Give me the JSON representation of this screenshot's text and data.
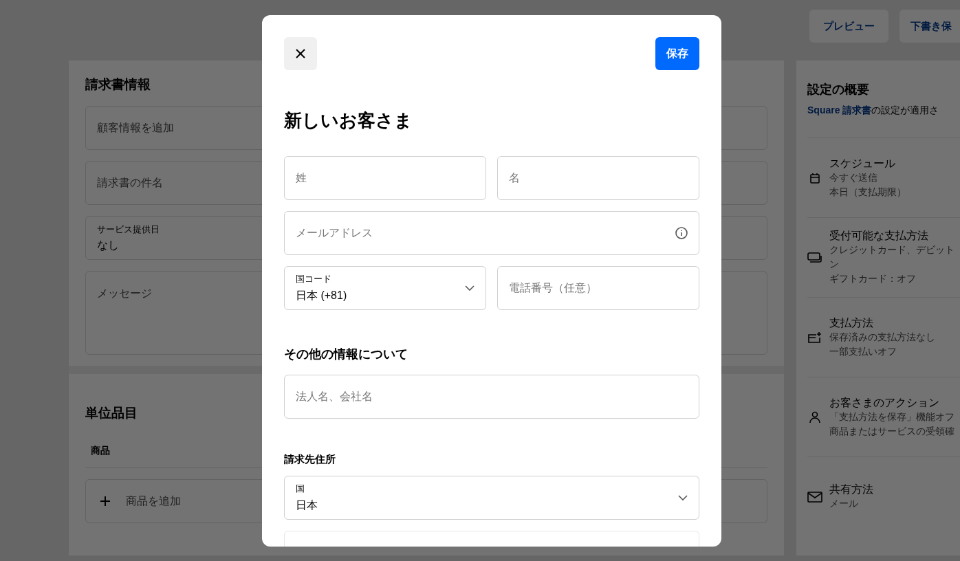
{
  "header": {
    "buttons": [
      "プレビュー",
      "下書き保"
    ]
  },
  "invoice_info": {
    "title": "請求書情報",
    "fields": [
      {
        "kind": "input",
        "placeholder": "顧客情報を追加"
      },
      {
        "kind": "input",
        "placeholder": "請求書の件名"
      },
      {
        "kind": "labeled",
        "label": "サービス提供日",
        "value": "なし"
      },
      {
        "kind": "textarea",
        "placeholder": "メッセージ"
      }
    ]
  },
  "line_items": {
    "title": "単位品目",
    "column_1": "商品",
    "add_item": "商品を追加"
  },
  "settings_summary": {
    "title": "設定の概要",
    "link": "Square 請求書",
    "link_rest": "の設定が適用さ",
    "items": [
      {
        "title": "スケジュール",
        "lines": [
          "今すぐ送信",
          "本日（支払期限）"
        ]
      },
      {
        "title": "受付可能な支払方法",
        "lines": [
          "クレジットカード、デビット",
          "ン",
          "ギフトカード：オフ"
        ]
      },
      {
        "title": "支払方法",
        "lines": [
          "保存済みの支払方法なし",
          "一部支払いオフ"
        ]
      },
      {
        "title": "お客さまのアクション",
        "lines": [
          "「支払方法を保存」機能オフ",
          "商品またはサービスの受領確"
        ]
      },
      {
        "title": "共有方法",
        "lines": [
          "メール"
        ]
      }
    ]
  },
  "modal": {
    "save_button": "保存",
    "title": "新しいお客さま",
    "contact_rows": [
      [
        {
          "kind": "input",
          "placeholder": "姓",
          "info": false
        },
        {
          "kind": "input",
          "placeholder": "名",
          "info": false
        }
      ],
      [
        {
          "kind": "input",
          "placeholder": "メールアドレス",
          "info": true
        }
      ],
      [
        {
          "kind": "select",
          "label": "国コード",
          "value": "日本 (+81)"
        },
        {
          "kind": "input",
          "placeholder": "電話番号（任意）",
          "info": false
        }
      ]
    ],
    "other_heading": "その他の情報について",
    "company_field": {
      "placeholder": "法人名、会社名"
    },
    "billing_heading": "請求先住所",
    "country_field": {
      "label": "国",
      "value": "日本"
    }
  }
}
